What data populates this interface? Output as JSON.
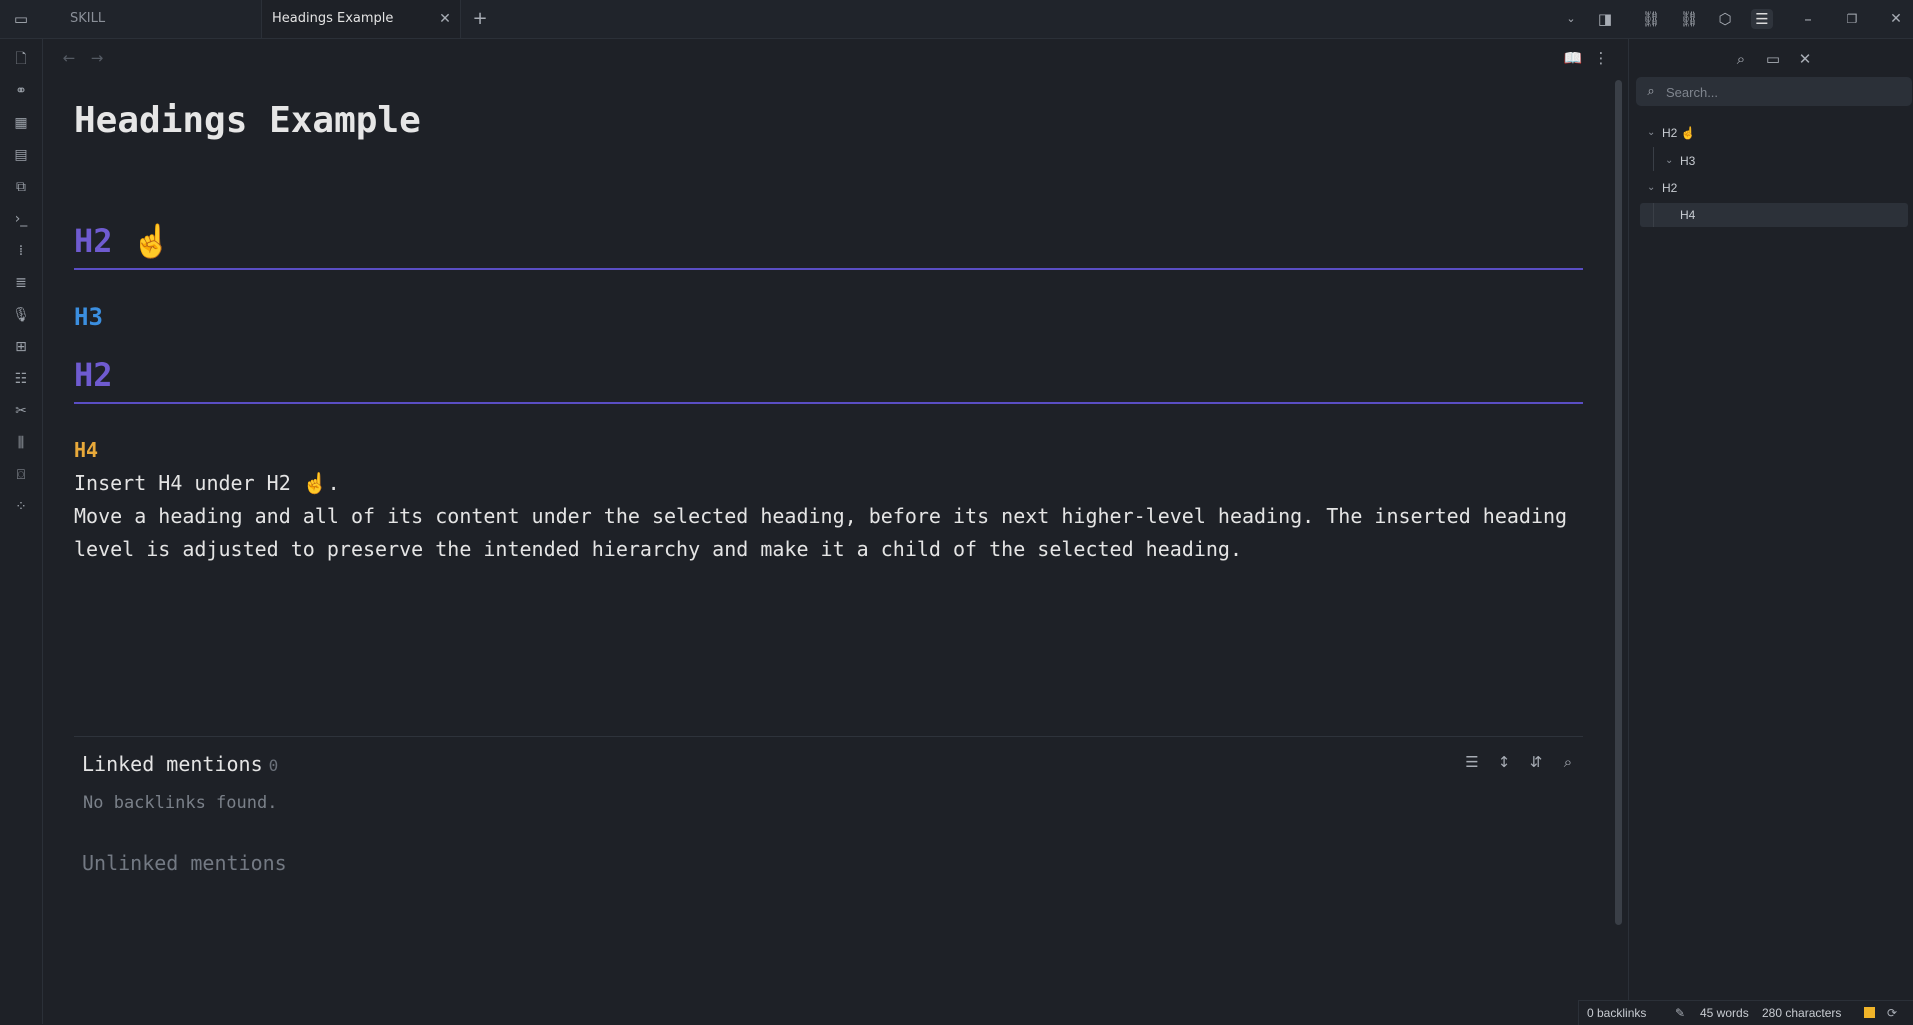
{
  "tabs": [
    {
      "label": "SKILL"
    },
    {
      "label": "Headings Example"
    }
  ],
  "note": {
    "title": "Headings Example",
    "headings": [
      {
        "level": "H2",
        "text": "H2 ☝️"
      },
      {
        "level": "H3",
        "text": "H3"
      },
      {
        "level": "H2",
        "text": "H2"
      },
      {
        "level": "H4",
        "text": "H4"
      }
    ],
    "line1": "Insert H4 under H2 ☝️.",
    "line2": "Move a heading and all of its content under the selected heading, before its next higher-level heading. The inserted heading level is adjusted to preserve the intended hierarchy and make it a child of the selected heading."
  },
  "backlinks": {
    "linked_title": "Linked mentions",
    "linked_count": "0",
    "empty_text": "No backlinks found.",
    "unlinked_title": "Unlinked mentions"
  },
  "outline": {
    "search_placeholder": "Search...",
    "items": [
      {
        "label": "H2 ☝"
      },
      {
        "label": "H3"
      },
      {
        "label": "H2"
      },
      {
        "label": "H4"
      }
    ]
  },
  "status": {
    "backlinks": "0 backlinks",
    "words": "45 words",
    "characters": "280 characters"
  },
  "colors": {
    "h2": "#6f5bd0",
    "h3": "#3b8fe0",
    "h4": "#e8a93a",
    "status_indicator": "#f0b429"
  }
}
